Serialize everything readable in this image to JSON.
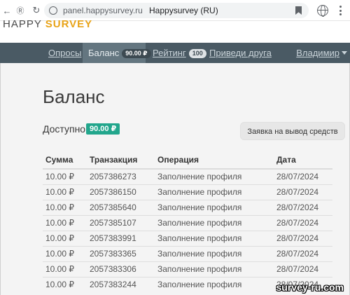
{
  "browser": {
    "url": "panel.happysurvey.ru",
    "tab_title": "Happysurvey (RU)",
    "icons": [
      "back-icon",
      "forward-icon",
      "reload-icon",
      "site-info-icon",
      "bookmark-icon",
      "globe-icon",
      "menu-icon"
    ]
  },
  "logo": {
    "part1": "HAPPY ",
    "part2": "SURVEY"
  },
  "nav": {
    "items": [
      {
        "label": "Опросы"
      },
      {
        "label": "Баланс",
        "badge": "90.00 ₽"
      },
      {
        "label": "Рейтинг",
        "badge": "100"
      },
      {
        "label": "Приведи друга"
      }
    ],
    "user": "Владимир"
  },
  "page": {
    "title": "Баланс",
    "available_label": "Доступно",
    "available_value": "90.00 ₽",
    "withdraw_label": "Заявка на вывод средств"
  },
  "table": {
    "headers": [
      "Сумма",
      "Транзакция",
      "Операция",
      "Дата"
    ],
    "rows": [
      [
        "10.00 ₽",
        "2057386273",
        "Заполнение профиля",
        "28/07/2024"
      ],
      [
        "10.00 ₽",
        "2057386150",
        "Заполнение профиля",
        "28/07/2024"
      ],
      [
        "10.00 ₽",
        "2057385640",
        "Заполнение профиля",
        "28/07/2024"
      ],
      [
        "10.00 ₽",
        "2057385107",
        "Заполнение профиля",
        "28/07/2024"
      ],
      [
        "10.00 ₽",
        "2057383991",
        "Заполнение профиля",
        "28/07/2024"
      ],
      [
        "10.00 ₽",
        "2057383365",
        "Заполнение профиля",
        "28/07/2024"
      ],
      [
        "10.00 ₽",
        "2057383306",
        "Заполнение профиля",
        "28/07/2024"
      ],
      [
        "10.00 ₽",
        "2057383244",
        "Заполнение профиля",
        "28/07/2024"
      ]
    ]
  },
  "watermark": "survey-ru.com",
  "colors": {
    "navbar": "#4a5a64",
    "active_tab": "#647680",
    "available_badge": "#22a68c",
    "logo_accent": "#e8a317"
  }
}
